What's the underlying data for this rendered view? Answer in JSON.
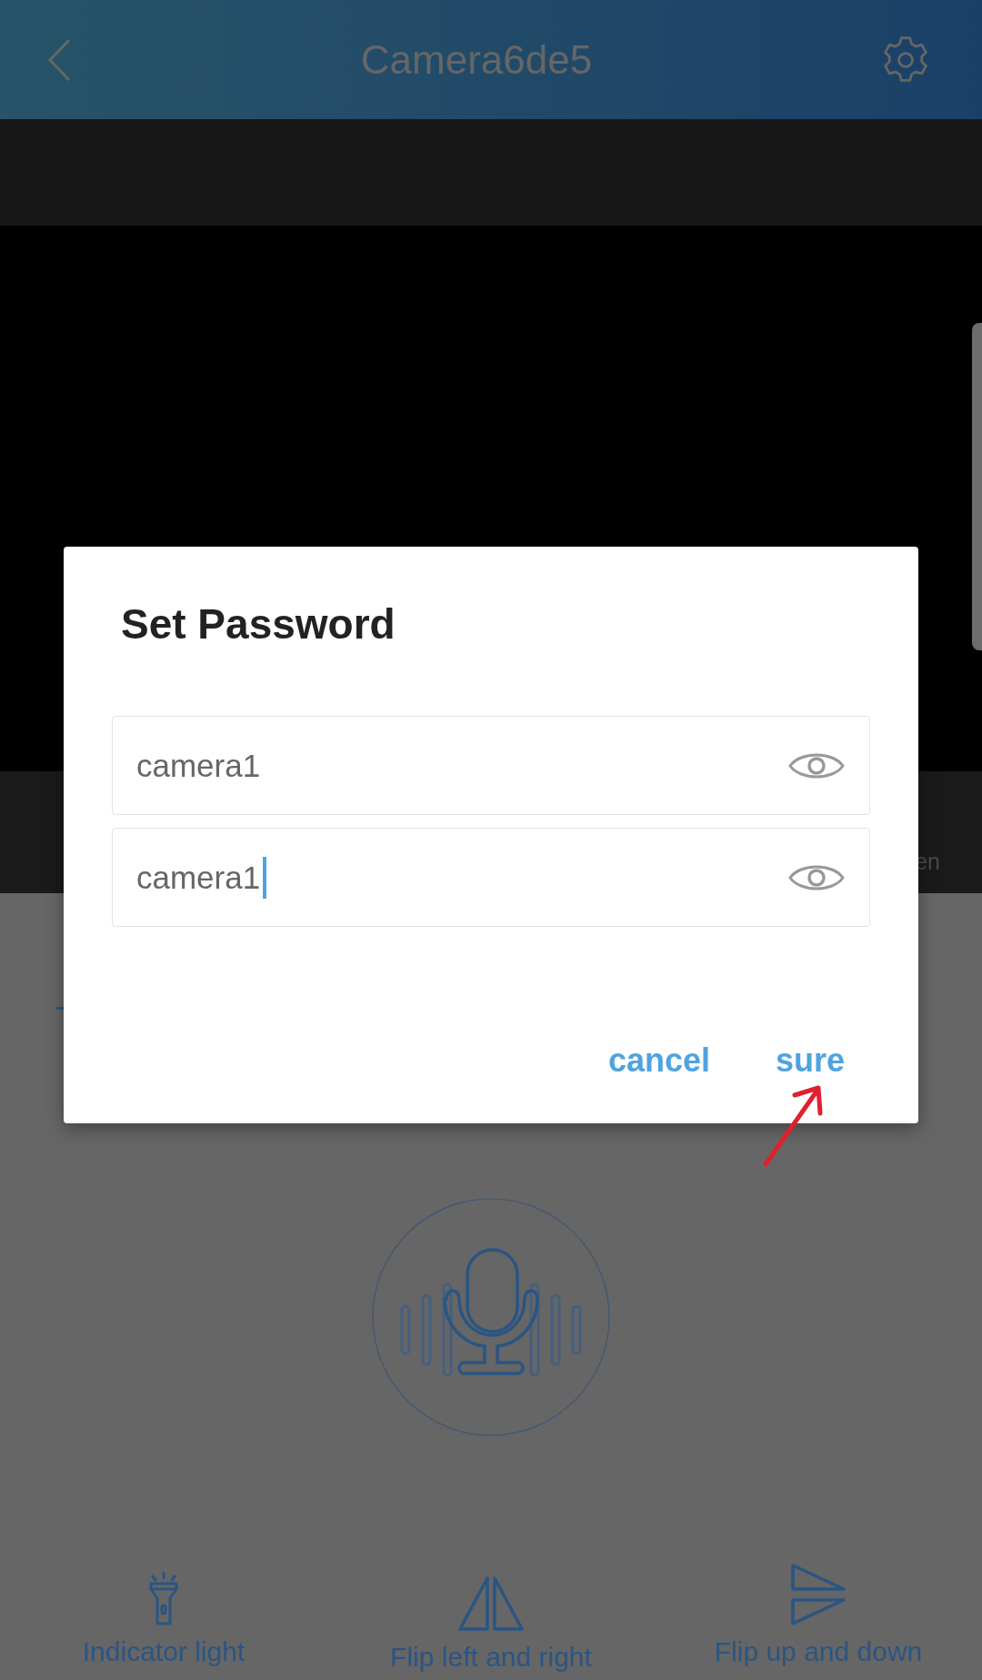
{
  "header": {
    "title": "Camera6de5"
  },
  "strip": {
    "partial_label": "en"
  },
  "dialog": {
    "title": "Set Password",
    "fields": [
      {
        "value": "camera1",
        "focused": false
      },
      {
        "value": "camera1",
        "focused": true
      }
    ],
    "buttons": [
      "cancel",
      "sure"
    ]
  },
  "controls": [
    {
      "label": "Indicator light",
      "kind": "flashlight"
    },
    {
      "label": "Flip left and right",
      "kind": "flip_horizontal"
    },
    {
      "label": "Flip up and down",
      "kind": "flip_vertical"
    }
  ]
}
